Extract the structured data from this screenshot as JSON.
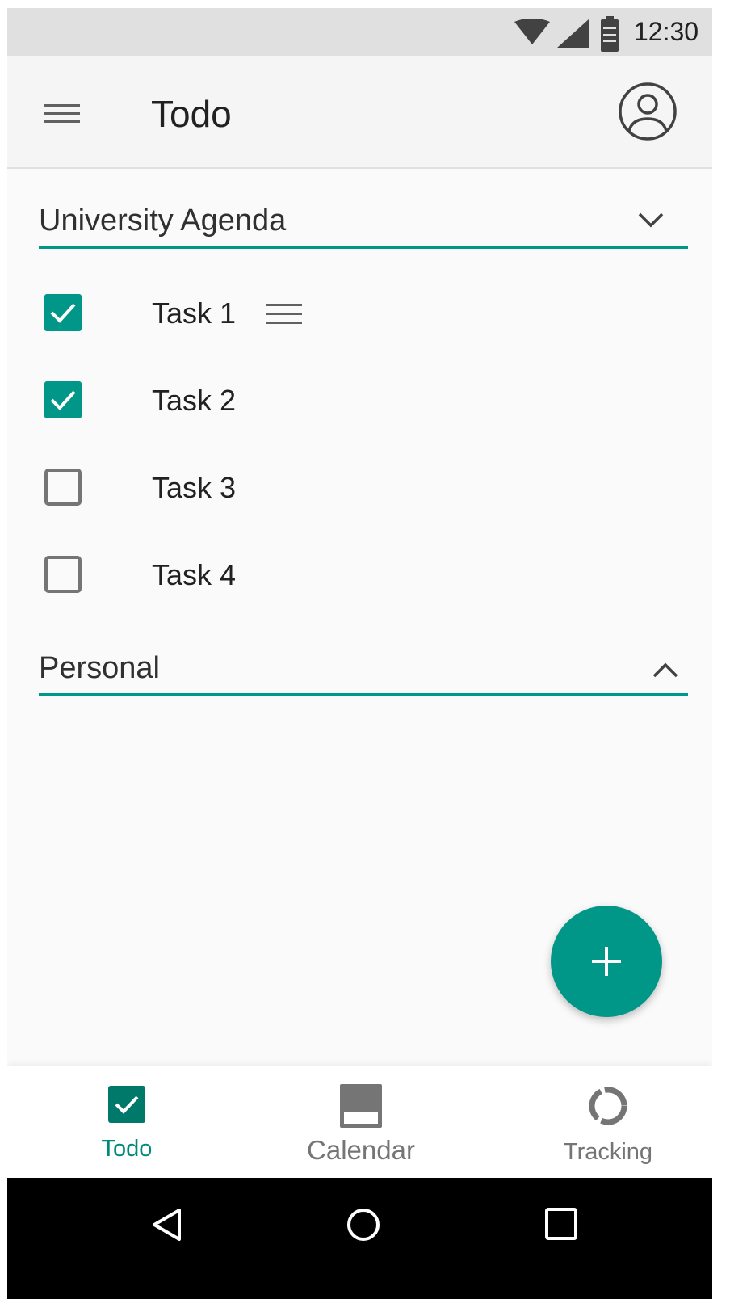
{
  "status_bar": {
    "time": "12:30",
    "icons": [
      "wifi-icon",
      "cell-signal-icon",
      "battery-icon"
    ]
  },
  "app_bar": {
    "title": "Todo",
    "menu_icon": "hamburger-menu-icon",
    "account_icon": "account-circle-icon"
  },
  "lists": [
    {
      "label": "University Agenda",
      "expanded": true,
      "toggle_icon": "chevron-down-icon",
      "tasks": [
        {
          "label": "Task 1",
          "checked": true,
          "drag_handle": true
        },
        {
          "label": "Task 2",
          "checked": true
        },
        {
          "label": "Task 3",
          "checked": false
        },
        {
          "label": "Task 4",
          "checked": false
        }
      ]
    },
    {
      "label": "Personal",
      "expanded": false,
      "toggle_icon": "chevron-up-icon",
      "tasks": []
    }
  ],
  "fab": {
    "icon": "plus-icon"
  },
  "bottom_nav": {
    "items": [
      {
        "label": "Todo",
        "icon": "todo-checkbox-icon",
        "active": true
      },
      {
        "label": "Calendar",
        "icon": "calendar-icon",
        "active": false
      },
      {
        "label": "Tracking",
        "icon": "tracking-ring-icon",
        "active": false
      }
    ]
  },
  "system_nav": {
    "icons": [
      "back-icon",
      "home-icon",
      "recents-icon"
    ]
  },
  "colors": {
    "accent": "#009688",
    "text": "#212121",
    "inactive": "#757575",
    "checkbox_off": "#757575"
  }
}
